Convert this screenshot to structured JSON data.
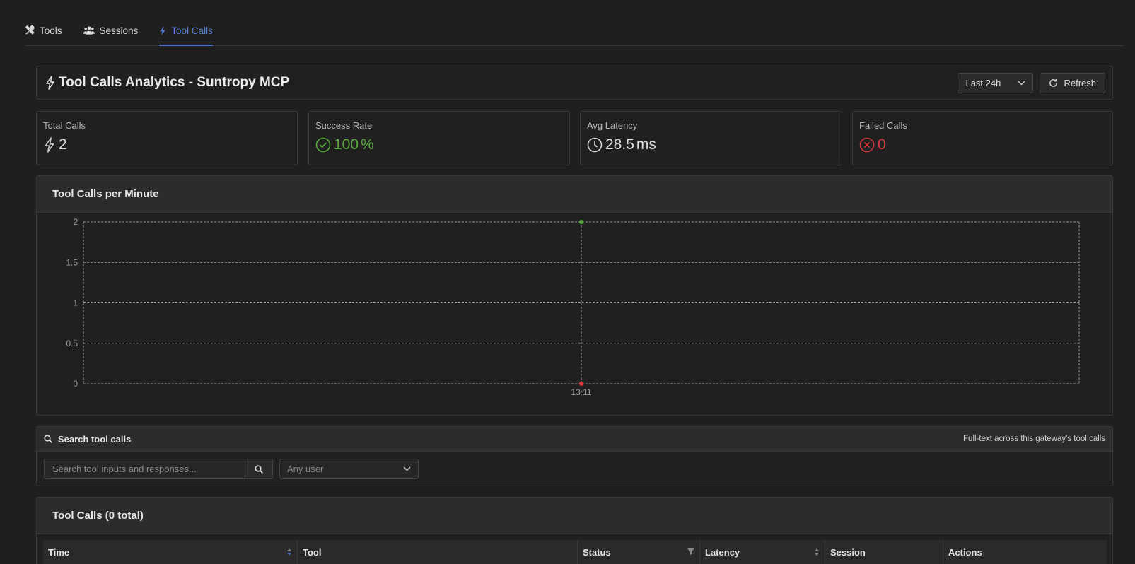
{
  "nav": {
    "tabs": [
      {
        "label": "Tools",
        "icon": "tools-icon"
      },
      {
        "label": "Sessions",
        "icon": "users-icon"
      },
      {
        "label": "Tool Calls",
        "icon": "lightning-icon"
      }
    ],
    "active_tab": "Tool Calls"
  },
  "header": {
    "title": "Tool Calls Analytics - Suntropy MCP",
    "range_select": "Last 24h",
    "refresh_label": "Refresh"
  },
  "stats": [
    {
      "label": "Total Calls",
      "value": "2",
      "unit": "",
      "icon": "lightning-icon",
      "color": "#dedede"
    },
    {
      "label": "Success Rate",
      "value": "100",
      "unit": "%",
      "icon": "check-circle-icon",
      "color": "#57a93b"
    },
    {
      "label": "Avg Latency",
      "value": "28.5",
      "unit": "ms",
      "icon": "clock-icon",
      "color": "#dedede"
    },
    {
      "label": "Failed Calls",
      "value": "0",
      "unit": "",
      "icon": "close-circle-icon",
      "color": "#d9363e"
    }
  ],
  "chart_section": {
    "title": "Tool Calls per Minute"
  },
  "chart_data": {
    "type": "line",
    "title": "Tool Calls per Minute",
    "categories": [
      "13:11"
    ],
    "series": [
      {
        "name": "",
        "values": [
          2
        ],
        "color": "#57a93b"
      },
      {
        "name": "",
        "values": [
          0
        ],
        "color": "#d9363e"
      }
    ],
    "ylim": [
      0,
      2
    ],
    "y_ticks": [
      "0",
      "0.5",
      "1",
      "1.5",
      "2"
    ],
    "grid": true
  },
  "search": {
    "title": "Search tool calls",
    "hint": "Full-text across this gateway's tool calls",
    "placeholder": "Search tool inputs and responses...",
    "user_placeholder": "Any user"
  },
  "table": {
    "title": "Tool Calls (0 total)",
    "columns": [
      "Time",
      "Tool",
      "Status",
      "Latency",
      "Session",
      "Actions"
    ]
  },
  "colors": {
    "accent": "#4f6fc9",
    "success": "#57a93b",
    "error": "#d9363e"
  }
}
